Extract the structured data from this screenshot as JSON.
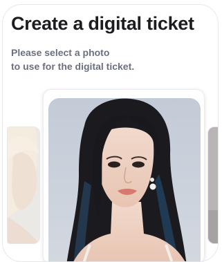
{
  "screen": {
    "title": "Create a digital ticket",
    "subtitle_line1": "Please select a photo",
    "subtitle_line2": "to use for the digital ticket."
  },
  "carousel": {
    "photos": [
      {
        "position": "previous",
        "state": "partially-visible"
      },
      {
        "position": "current",
        "state": "selected"
      },
      {
        "position": "next",
        "state": "partially-visible"
      }
    ]
  },
  "colors": {
    "title": "#1c1d21",
    "subtitle": "#6b6f80",
    "photo_background": "#c7cfdb",
    "card_border": "#e6e7eb"
  }
}
